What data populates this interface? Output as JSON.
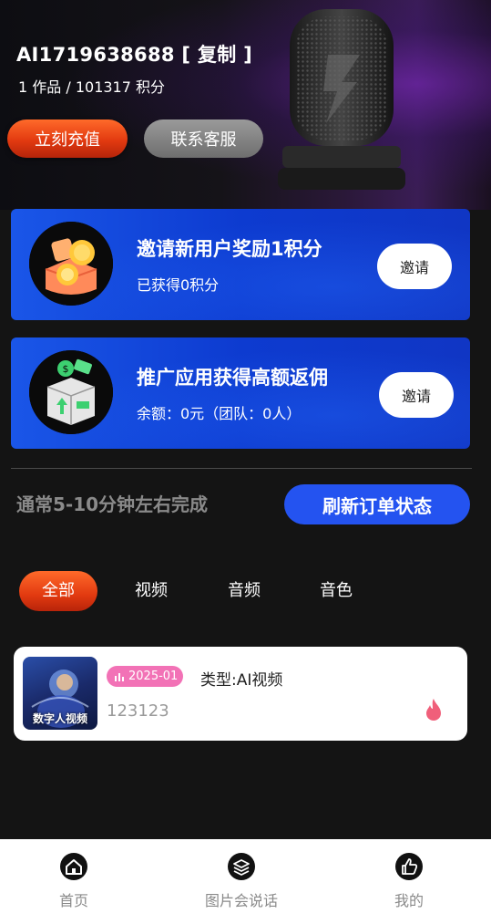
{
  "header": {
    "user_name": "AI1719638688 [ 复制 ]",
    "stats": "1 作品 / 101317 积分",
    "recharge_label": "立刻充值",
    "service_label": "联系客服"
  },
  "banners": [
    {
      "title": "邀请新用户奖励1积分",
      "subtitle": "已获得0积分",
      "button": "邀请"
    },
    {
      "title": "推广应用获得高额返佣",
      "subtitle": "余额：0元（团队：0人）",
      "button": "邀请"
    }
  ],
  "order": {
    "hint": "通常5-10分钟左右完成",
    "refresh_label": "刷新订单状态"
  },
  "tabs": [
    {
      "label": "全部",
      "active": true
    },
    {
      "label": "视频"
    },
    {
      "label": "音频"
    },
    {
      "label": "音色"
    }
  ],
  "card": {
    "thumbnail_label": "数字人视频",
    "date": "2025-01",
    "type": "类型:AI视频",
    "id": "123123"
  },
  "bottom_nav": [
    {
      "label": "首页",
      "icon": "home-icon"
    },
    {
      "label": "图片会说话",
      "icon": "layers-icon"
    },
    {
      "label": "我的",
      "icon": "thumbs-up-icon"
    }
  ],
  "colors": {
    "accent_orange": "#e23a10",
    "accent_blue": "#2453f0",
    "banner_blue": "#1036c4",
    "badge_pink": "#f272b6"
  }
}
